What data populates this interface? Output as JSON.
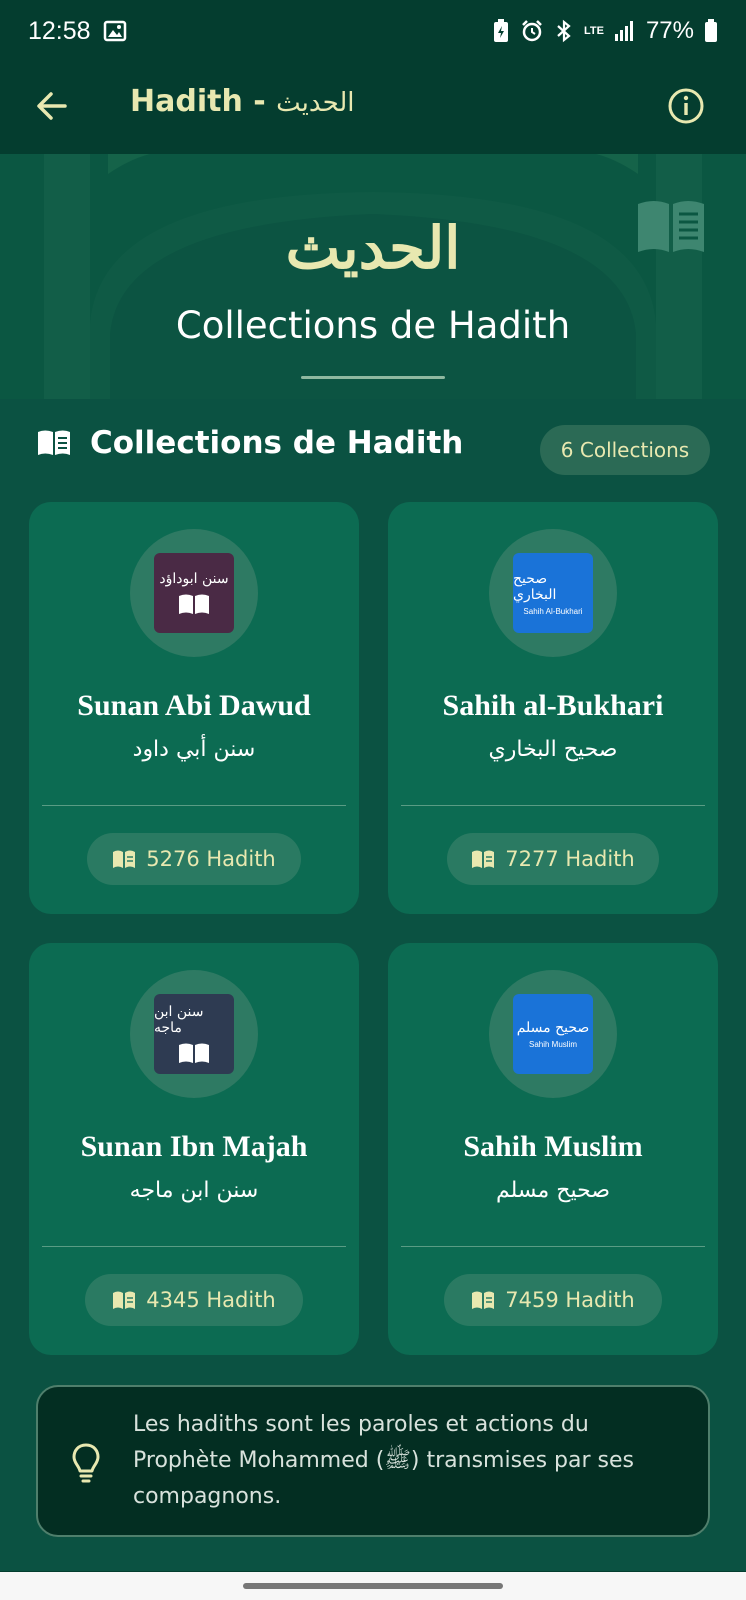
{
  "status_bar": {
    "time": "12:58",
    "battery_percent": "77%",
    "network_label": "LTE",
    "icons": [
      "gallery-icon",
      "battery-saver-icon",
      "alarm-icon",
      "bluetooth-icon",
      "lte-icon",
      "signal-icon",
      "battery-icon"
    ]
  },
  "app_bar": {
    "title_en": "Hadith - ",
    "title_ar": "الحديث",
    "back_icon": "arrow-left-icon",
    "info_icon": "info-icon"
  },
  "hero": {
    "arabic_title": "الحديث",
    "subtitle": "Collections de Hadith"
  },
  "section": {
    "title": "Collections de Hadith",
    "count_label": "6 Collections"
  },
  "collections": [
    {
      "name": "Sunan Abi Dawud",
      "name_ar": "سنن أبي داود",
      "count": "5276 Hadith",
      "logo_ar": "سنن ابوداؤد",
      "logo_en": "",
      "logo_color": "#4a2a45"
    },
    {
      "name": "Sahih al-Bukhari",
      "name_ar": "صحيح البخاري",
      "count": "7277 Hadith",
      "logo_ar": "صحيح البخاري",
      "logo_en": "Sahih Al-Bukhari",
      "logo_color": "#1a73d8"
    },
    {
      "name": "Sunan Ibn Majah",
      "name_ar": "سنن ابن ماجه",
      "count": "4345 Hadith",
      "logo_ar": "سنن ابن ماجه",
      "logo_en": "",
      "logo_color": "#2e3b52"
    },
    {
      "name": "Sahih Muslim",
      "name_ar": "صحيح مسلم",
      "count": "7459 Hadith",
      "logo_ar": "صحيح مسلم",
      "logo_en": "Sahih Muslim",
      "logo_color": "#1a73d8"
    }
  ],
  "info": {
    "text": "Les hadiths sont les paroles et actions du Prophète Mohammed (ﷺ) transmises par ses compagnons.",
    "icon": "lightbulb-icon"
  },
  "colors": {
    "background": "#043d2f",
    "card": "#0c6b52",
    "accent_text": "#e8e8b0"
  }
}
